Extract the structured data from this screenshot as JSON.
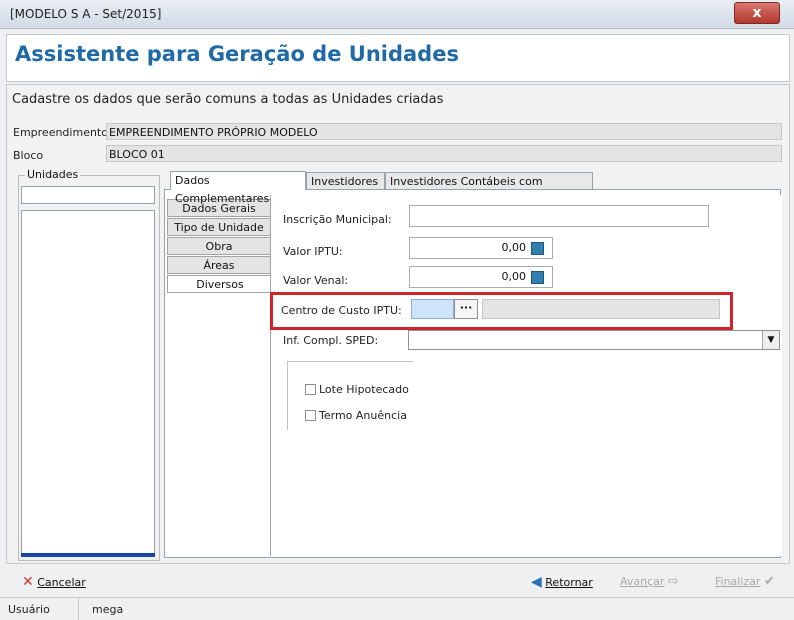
{
  "window": {
    "title": "[MODELO S A - Set/2015]",
    "close_label": "x"
  },
  "header": {
    "title": "Assistente para Geração de Unidades"
  },
  "instructions": "Cadastre os dados que serão comuns a todas as Unidades criadas",
  "empreendimento": {
    "label": "Empreendimento:",
    "value": "EMPREENDIMENTO PRÓPRIO MODELO"
  },
  "bloco": {
    "label": "Bloco",
    "value": "BLOCO 01"
  },
  "units": {
    "label": "Unidades"
  },
  "tabs": [
    {
      "label": "Dados Complementares",
      "active": true
    },
    {
      "label": "Investidores",
      "active": false
    },
    {
      "label": "Investidores Contábeis com Vigência",
      "active": false
    }
  ],
  "subtabs": [
    {
      "label": "Dados Gerais"
    },
    {
      "label": "Tipo de Unidade"
    },
    {
      "label": "Obra"
    },
    {
      "label": "Áreas"
    },
    {
      "label": "Diversos",
      "active": true
    }
  ],
  "form": {
    "inscricao_label": "Inscrição Municipal:",
    "inscricao_value": "",
    "iptu_label": "Valor IPTU:",
    "iptu_value": "0,00",
    "venal_label": "Valor Venal:",
    "venal_value": "0,00",
    "centro_label": "Centro de Custo IPTU:",
    "centro_btn": "···",
    "sped_label": "Inf. Compl. SPED:",
    "sped_value": ""
  },
  "checkboxes": [
    {
      "label": "Lote Hipotecado",
      "checked": false
    },
    {
      "label": "Termo Anuência",
      "checked": false
    }
  ],
  "footer": {
    "cancel": "Cancelar",
    "back": "Retornar",
    "next": "Avançar",
    "finish": "Finalizar"
  },
  "status": {
    "user_label": "Usuário",
    "user_value": "mega"
  },
  "colors": {
    "title_blue": "#1f6aa6",
    "highlight_red": "#cf2429",
    "accent_blue": "#1747a6"
  }
}
